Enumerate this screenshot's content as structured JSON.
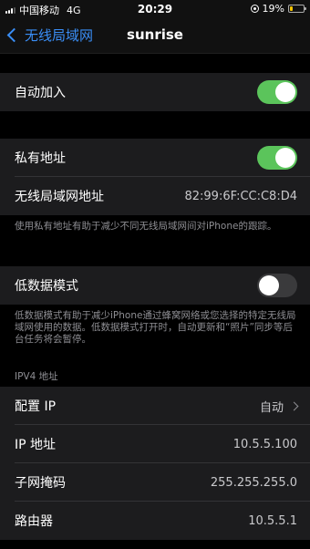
{
  "status_bar": {
    "carrier": "中国移动",
    "network": "4G",
    "time": "20:29",
    "battery_percent": "19%",
    "battery_color": "#f5c400"
  },
  "nav": {
    "back_label": "无线局域网",
    "title": "sunrise",
    "back_icon": "chevron-left-icon"
  },
  "auto_join": {
    "label": "自动加入",
    "enabled": true
  },
  "private_address": {
    "label": "私有地址",
    "enabled": true,
    "wifi_address_label": "无线局域网地址",
    "wifi_address_value": "82:99:6F:CC:C8:D4",
    "footnote": "使用私有地址有助于减少不同无线局域网间对iPhone的跟踪。"
  },
  "low_data_mode": {
    "label": "低数据模式",
    "enabled": false,
    "footnote": "低数据模式有助于减少iPhone通过蜂窝网络或您选择的特定无线局域网使用的数据。低数据模式打开时，自动更新和“照片”同步等后台任务将会暂停。"
  },
  "ipv4": {
    "header": "IPV4 地址",
    "rows": [
      {
        "label": "配置 IP",
        "value": "自动"
      },
      {
        "label": "IP 地址",
        "value": "10.5.5.100"
      },
      {
        "label": "子网掩码",
        "value": "255.255.255.0"
      },
      {
        "label": "路由器",
        "value": "10.5.5.1"
      }
    ]
  },
  "colors": {
    "accent": "#3a8ef6",
    "toggle_on": "#5bc45b",
    "toggle_off": "#3a3a3c",
    "cell_bg": "#1c1c1e"
  }
}
